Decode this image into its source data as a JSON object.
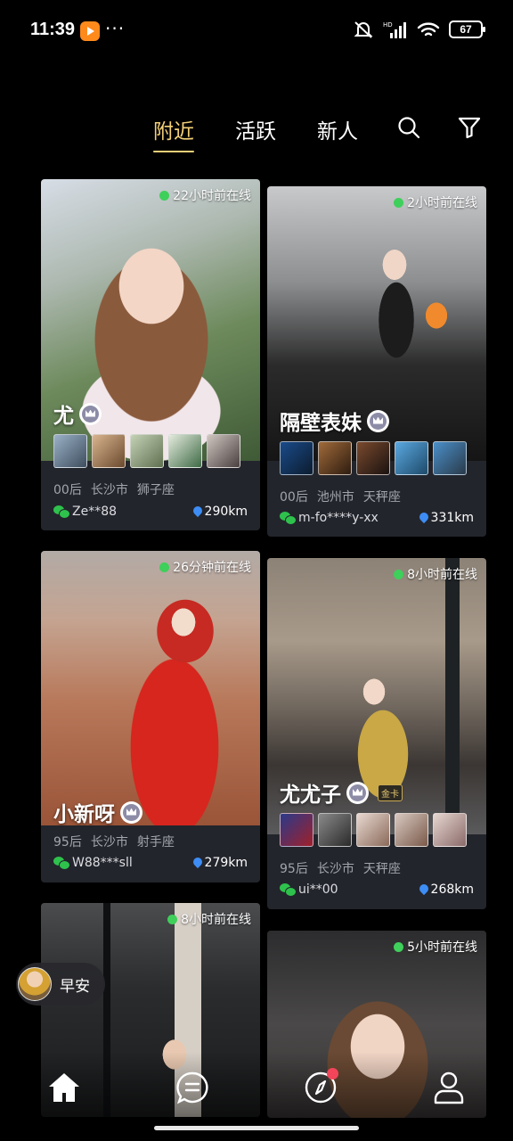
{
  "status_bar": {
    "time": "11:39",
    "battery": "67",
    "more": "···"
  },
  "tabs": [
    {
      "label": "附近",
      "active": true
    },
    {
      "label": "活跃",
      "active": false
    },
    {
      "label": "新人",
      "active": false
    }
  ],
  "cards": [
    {
      "online": "22小时前在线",
      "name": "尤",
      "info": [
        "00后",
        "长沙市",
        "狮子座"
      ],
      "wechat": "Ze**88",
      "distance": "290km"
    },
    {
      "online": "2小时前在线",
      "name": "隔壁表妹",
      "info": [
        "00后",
        "池州市",
        "天秤座"
      ],
      "wechat": "m-fo****y-xx",
      "distance": "331km"
    },
    {
      "online": "26分钟前在线",
      "name": "小新呀",
      "info": [
        "95后",
        "长沙市",
        "射手座"
      ],
      "wechat": "W88***sll",
      "distance": "279km"
    },
    {
      "online": "8小时前在线",
      "name": "尤尤子",
      "badge": "金卡",
      "info": [
        "95后",
        "长沙市",
        "天秤座"
      ],
      "wechat": "ui**00",
      "distance": "268km"
    },
    {
      "online": "8小时前在线"
    },
    {
      "online": "5小时前在线"
    }
  ],
  "greeting": {
    "text": "早安"
  },
  "colors": {
    "accent": "#f4d078",
    "online": "#3fcf5b",
    "card_bg": "#23252c",
    "wechat": "#2ec24d",
    "pin": "#3d8df5"
  }
}
